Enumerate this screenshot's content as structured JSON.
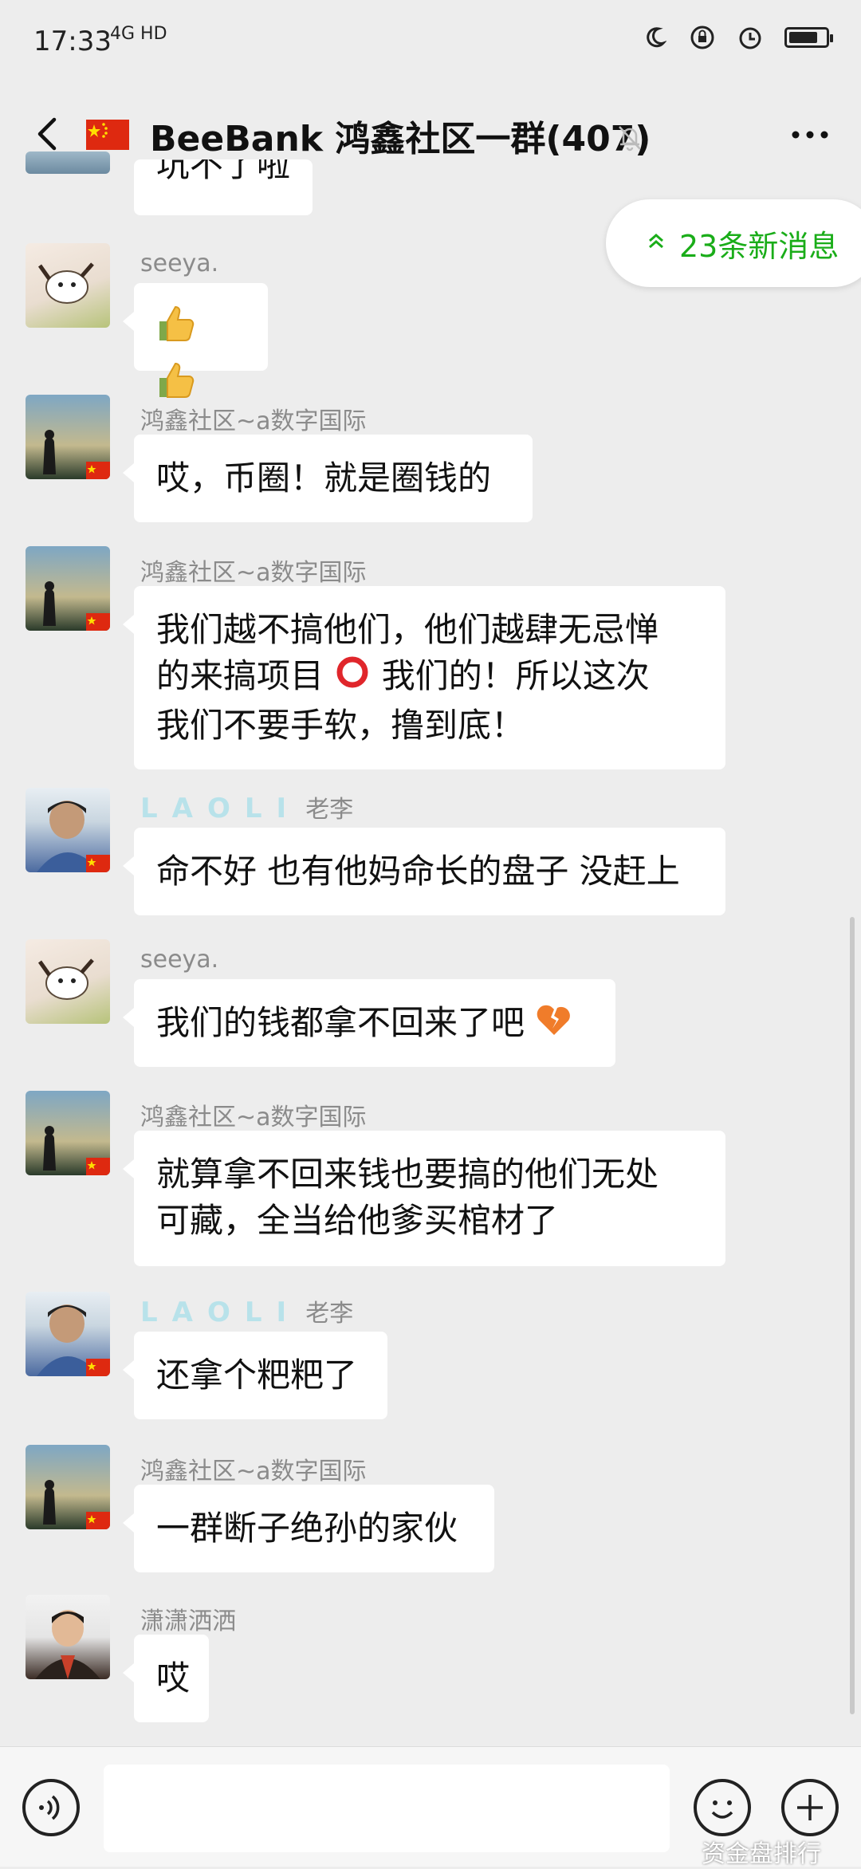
{
  "status_bar": {
    "time": "17:33",
    "network": "4G HD"
  },
  "header": {
    "title": "BeeBank 鸿鑫社区一群(407)"
  },
  "new_messages": {
    "label": "23条新消息"
  },
  "messages": [
    {
      "text": "坑不了啦"
    },
    {
      "nick": "seeya."
    },
    {
      "nick": "鸿鑫社区~a数字国际",
      "text": "哎，币圈！就是圈钱的"
    },
    {
      "nick": "鸿鑫社区~a数字国际",
      "text_1": "我们越不搞他们，他们越肆无忌惮",
      "text_2": "的来搞项目",
      "text_3": "我们的！所以这次",
      "text_4": "我们不要手软，撸到底！"
    },
    {
      "nick_brand": "LAOLI",
      "nick": "老李",
      "text": "命不好 也有他妈命长的盘子 没赶上"
    },
    {
      "nick": "seeya.",
      "text": "我们的钱都拿不回来了吧"
    },
    {
      "nick": "鸿鑫社区~a数字国际",
      "text_1": "就算拿不回来钱也要搞的他们无处",
      "text_2": "可藏，全当给他爹买棺材了"
    },
    {
      "nick_brand": "LAOLI",
      "nick": "老李",
      "text": "还拿个粑粑了"
    },
    {
      "nick": "鸿鑫社区~a数字国际",
      "text": "一群断子绝孙的家伙"
    },
    {
      "nick": "潇潇洒洒",
      "text": "哎"
    }
  ],
  "watermark": "资金盘排行",
  "colors": {
    "accent": "#1aad19",
    "background": "#ededed",
    "bubble": "#ffffff"
  }
}
